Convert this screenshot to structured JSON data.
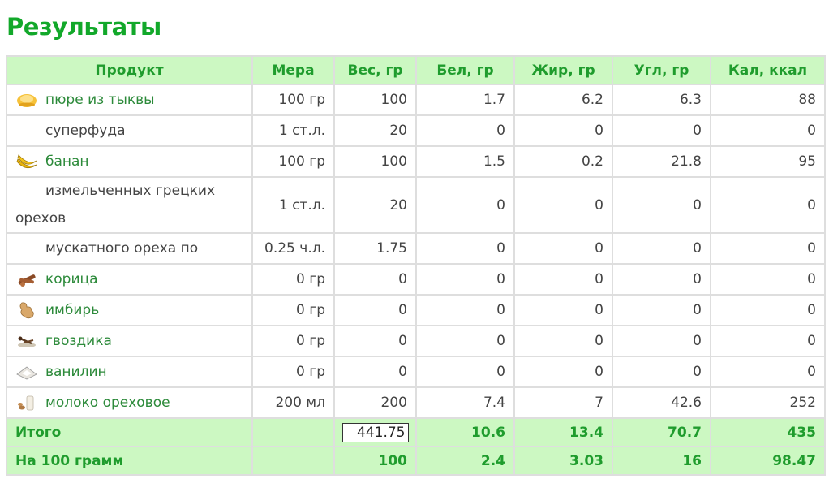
{
  "page_title": "Результаты",
  "headers": [
    "Продукт",
    "Мера",
    "Вес, гр",
    "Бел, гр",
    "Жир, гр",
    "Угл, гр",
    "Кал, ккал"
  ],
  "rows": [
    {
      "icon": "pumpkin-puree-icon",
      "product": "пюре из тыквы",
      "link": true,
      "measure": "100 гр",
      "weight": "100",
      "protein": "1.7",
      "fat": "6.2",
      "carbs": "6.3",
      "kcal": "88"
    },
    {
      "icon": "",
      "product": "суперфуда",
      "link": false,
      "measure": "1 ст.л.",
      "weight": "20",
      "protein": "0",
      "fat": "0",
      "carbs": "0",
      "kcal": "0"
    },
    {
      "icon": "banana-icon",
      "product": "банан",
      "link": true,
      "measure": "100 гр",
      "weight": "100",
      "protein": "1.5",
      "fat": "0.2",
      "carbs": "21.8",
      "kcal": "95"
    },
    {
      "icon": "",
      "product": "измельченных грецких орехов",
      "link": false,
      "measure": "1 ст.л.",
      "weight": "20",
      "protein": "0",
      "fat": "0",
      "carbs": "0",
      "kcal": "0"
    },
    {
      "icon": "",
      "product": "мускатного ореха по",
      "link": false,
      "measure": "0.25 ч.л.",
      "weight": "1.75",
      "protein": "0",
      "fat": "0",
      "carbs": "0",
      "kcal": "0"
    },
    {
      "icon": "cinnamon-icon",
      "product": "корица",
      "link": true,
      "measure": "0 гр",
      "weight": "0",
      "protein": "0",
      "fat": "0",
      "carbs": "0",
      "kcal": "0"
    },
    {
      "icon": "ginger-icon",
      "product": "имбирь",
      "link": true,
      "measure": "0 гр",
      "weight": "0",
      "protein": "0",
      "fat": "0",
      "carbs": "0",
      "kcal": "0"
    },
    {
      "icon": "clove-icon",
      "product": "гвоздика",
      "link": true,
      "measure": "0 гр",
      "weight": "0",
      "protein": "0",
      "fat": "0",
      "carbs": "0",
      "kcal": "0"
    },
    {
      "icon": "vanillin-icon",
      "product": "ванилин",
      "link": true,
      "measure": "0 гр",
      "weight": "0",
      "protein": "0",
      "fat": "0",
      "carbs": "0",
      "kcal": "0"
    },
    {
      "icon": "nut-milk-icon",
      "product": "молоко ореховое",
      "link": true,
      "measure": "200 мл",
      "weight": "200",
      "protein": "7.4",
      "fat": "7",
      "carbs": "42.6",
      "kcal": "252"
    }
  ],
  "total": {
    "label": "Итого",
    "weight": "441.75",
    "protein": "10.6",
    "fat": "13.4",
    "carbs": "70.7",
    "kcal": "435"
  },
  "per100": {
    "label": "На 100 грамм",
    "weight": "100",
    "protein": "2.4",
    "fat": "3.03",
    "carbs": "16",
    "kcal": "98.47"
  },
  "colors": {
    "accent": "#12a82a",
    "header_bg": "#ccf8c2",
    "link": "#2c8a3a"
  }
}
